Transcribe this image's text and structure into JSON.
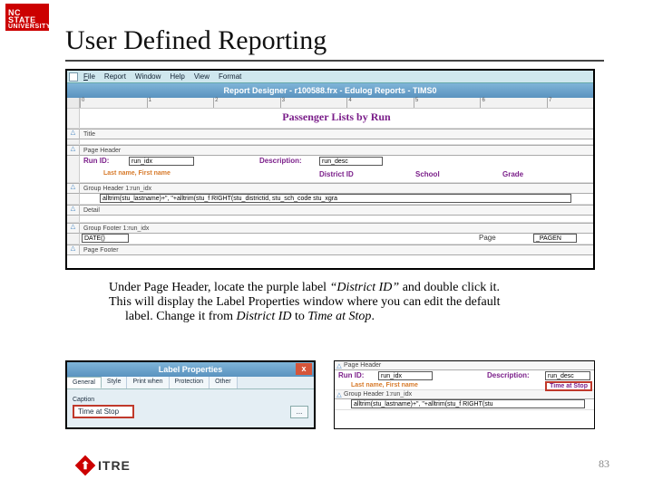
{
  "logo": {
    "line1": "NC STATE",
    "line2": "UNIVERSITY"
  },
  "slide": {
    "title": "User Defined Reporting"
  },
  "designer": {
    "menus": [
      "File",
      "Report",
      "Window",
      "Help",
      "View",
      "Format"
    ],
    "title": "Report Designer - r100588.frx - Edulog Reports - TIMS0",
    "ruler_marks": [
      "0",
      "1",
      "2",
      "3",
      "4",
      "5",
      "6",
      "7"
    ],
    "report_title": "Passenger Lists by Run",
    "bands": {
      "title": "Title",
      "page_header": "Page Header",
      "group_header": "Group Header 1:run_idx",
      "detail": "Detail",
      "group_footer": "Group Footer 1:run_idx",
      "page_footer": "Page Footer"
    },
    "ph_labels": {
      "runid": "Run ID:",
      "description": "Description:",
      "lastfirst": "Last name, First name",
      "district": "District ID",
      "school": "School",
      "grade": "Grade"
    },
    "ph_fields": {
      "run_idx": "run_idx",
      "run_desc": "run_desc"
    },
    "detail_expr": "alltrim(stu_lastname)+\", \"+alltrim(stu_f RIGHT(stu_districtid, stu_sch_code  stu_xgra",
    "pf_fields": {
      "date": "DATE()",
      "page_lbl": "Page",
      "page_fn": "_PAGEN"
    }
  },
  "instruction": {
    "line1a": "Under Page Header, locate the purple label ",
    "line1b": "“District ID”",
    "line1c": " and double click it.",
    "line2a": "This will display the Label Properties window where you can edit the default",
    "line3a": "label. Change it from ",
    "line3b": "District ID",
    "line3c": " to ",
    "line3d": "Time at Stop",
    "line3e": "."
  },
  "label_props": {
    "title": "Label Properties",
    "close": "x",
    "tabs": [
      "General",
      "Style",
      "Print when",
      "Protection",
      "Other"
    ],
    "caption_lbl": "Caption",
    "caption_val": "Time at Stop",
    "ellipsis": "..."
  },
  "result": {
    "band_ph": "Page Header",
    "runid": "Run ID:",
    "run_idx": "run_idx",
    "description": "Description:",
    "run_desc": "run_desc",
    "lastfirst": "Last name, First name",
    "time_at_stop": "Time at Stop",
    "band_gh": "Group Header 1:run_idx",
    "detail_expr": "alltrim(stu_lastname)+\", \"+alltrim(stu_f RIGHT(stu"
  },
  "footer": {
    "itre": "ITRE",
    "arrow": "⬆",
    "page": "83"
  }
}
